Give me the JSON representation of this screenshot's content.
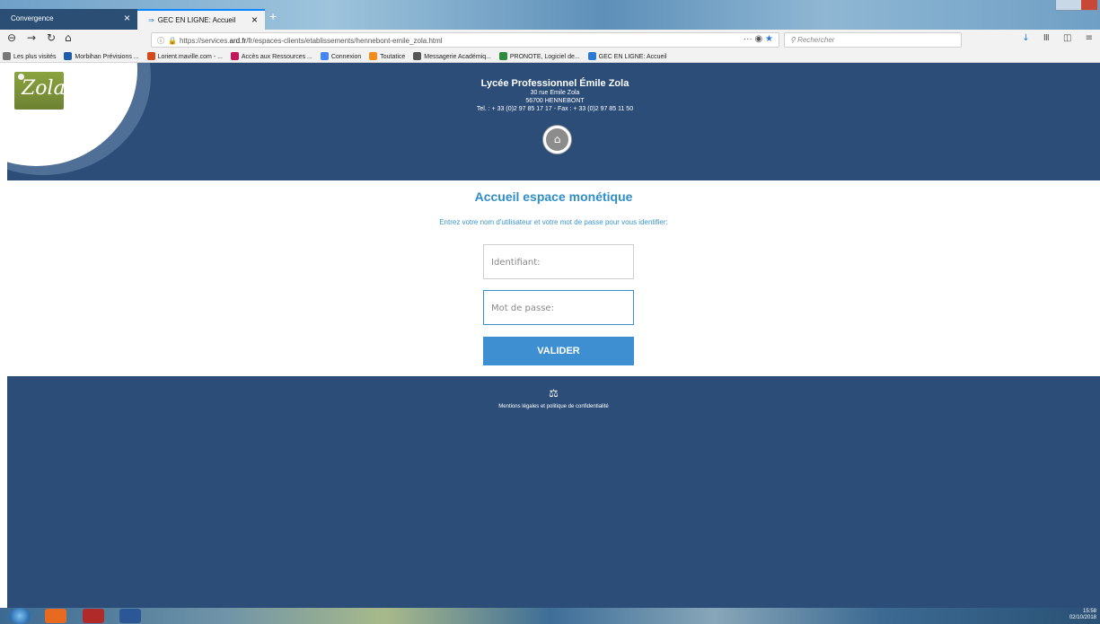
{
  "browser": {
    "tabs": [
      {
        "label": "Convergence",
        "active": false
      },
      {
        "label": "GEC EN LIGNE: Accueil",
        "active": true
      }
    ],
    "url_prefix": "https://services.",
    "url_host": "ard.fr",
    "url_path": "/fr/espaces-clients/etablissements/hennebont-emile_zola.html",
    "search_placeholder": "Rechercher",
    "bookmarks": [
      {
        "label": "Les plus visités",
        "color": "#777777"
      },
      {
        "label": "Morbihan Prévisions ...",
        "color": "#1d5fa8"
      },
      {
        "label": "Lorient.maville.com - ...",
        "color": "#d34a1c"
      },
      {
        "label": "Accès aux Ressources ...",
        "color": "#c2185b"
      },
      {
        "label": "Connexion",
        "color": "#4285f4"
      },
      {
        "label": "Toutatice",
        "color": "#f28c1a"
      },
      {
        "label": "Messagerie Académiq...",
        "color": "#555555"
      },
      {
        "label": "PRONOTE, Logiciel de...",
        "color": "#2e8b3d"
      },
      {
        "label": "GEC EN LIGNE: Accueil",
        "color": "#2a7ad5"
      }
    ]
  },
  "header": {
    "logo_text": "Zola",
    "school_name": "Lycée Professionnel Émile Zola",
    "address_line1": "30 rue Emile Zola",
    "address_line2": "56700 HENNEBONT",
    "contact_line": "Tel. : + 33 (0)2 97 85 17 17 - Fax : + 33 (0)2 97 85 11 50"
  },
  "login": {
    "title": "Accueil espace monétique",
    "instruction": "Entrez votre nom d'utilisateur et votre mot de passe pour vous identifier:",
    "username_placeholder": "Identifiant:",
    "password_placeholder": "Mot de passe:",
    "submit_label": "VALIDER"
  },
  "footer": {
    "legal_link": "Mentions légales et politique de confidentialité"
  },
  "taskbar": {
    "time": "15:58",
    "date": "02/10/2018"
  },
  "colors": {
    "header_bg": "#2b4d77",
    "accent": "#2f8dc8",
    "button_bg": "#3d8fd2"
  }
}
